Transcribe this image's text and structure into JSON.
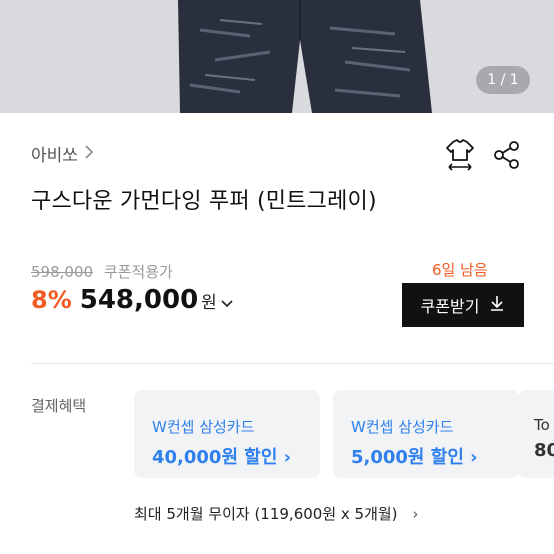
{
  "image": {
    "counter": "1 / 1"
  },
  "brand": {
    "name": "아비쏘",
    "chevron_icon": "chevron-right-icon"
  },
  "actions": {
    "size_icon": "tshirt-size-icon",
    "share_icon": "share-icon"
  },
  "product": {
    "title": "구스다운 가먼다잉 푸퍼 (민트그레이)"
  },
  "price": {
    "original": "598,000",
    "coupon_label": "쿠폰적용가",
    "discount": "8%",
    "final": "548,000",
    "currency": "원",
    "caret": "⌄"
  },
  "coupon": {
    "remaining": "6일 남음",
    "button_label": "쿠폰받기",
    "download_icon": "download-icon"
  },
  "payment": {
    "label": "결제혜택",
    "cards": [
      {
        "title": "W컨셉 삼성카드",
        "amount": "40,000원 할인 ›"
      },
      {
        "title": "W컨셉 삼성카드",
        "amount": "5,000원 할인 ›"
      },
      {
        "title": "To",
        "amount": "80"
      }
    ],
    "installment": "최대 5개월 무이자 (119,600원 x 5개월)",
    "installment_chevron": "›"
  },
  "colors": {
    "accent_orange": "#f15a22",
    "accent_blue": "#2f80ed",
    "button_black": "#111111"
  }
}
